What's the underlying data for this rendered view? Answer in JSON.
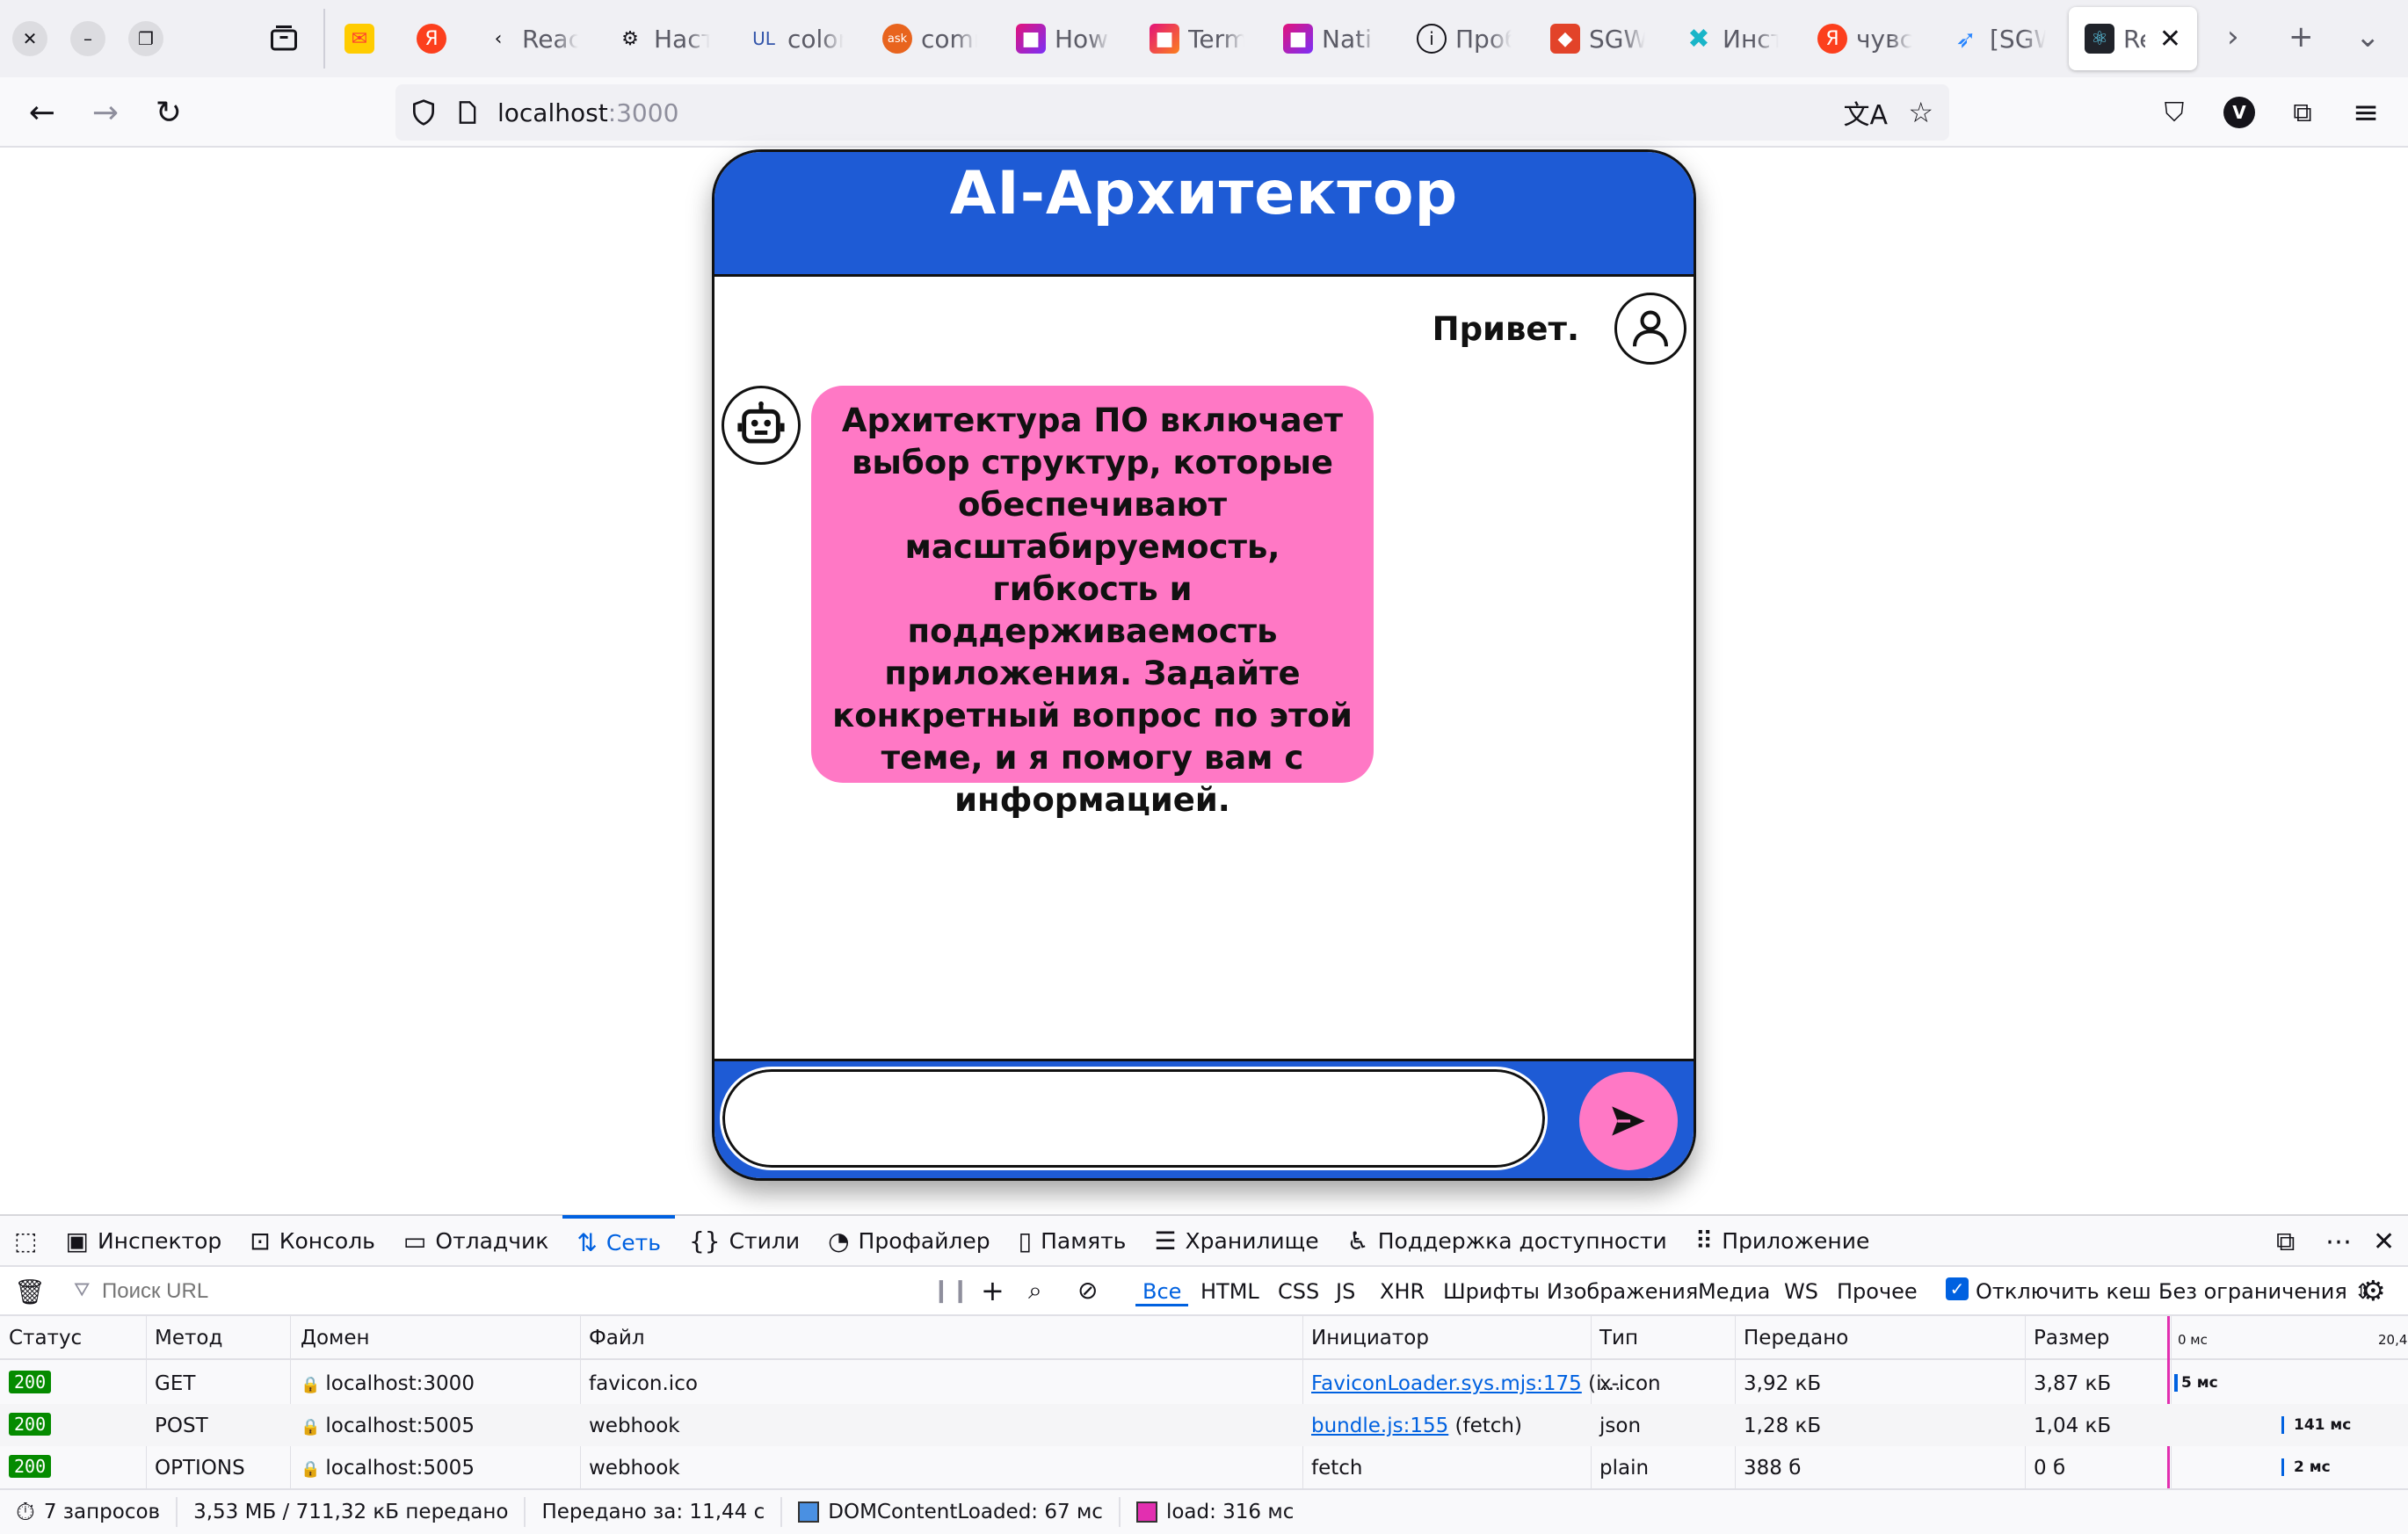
{
  "browser": {
    "tabs": [
      {
        "title": "",
        "favicon": "mail-icon",
        "color": "#ff3b30"
      },
      {
        "title": "",
        "favicon": "yandex-icon",
        "color": "#fc3f1d"
      },
      {
        "title": "Reac",
        "favicon": "chevron-left-icon",
        "color": "#15141a"
      },
      {
        "title": "Наст",
        "favicon": "gear-icon",
        "color": "#15141a"
      },
      {
        "title": "color",
        "favicon": "ul-icon",
        "color": "#3355aa"
      },
      {
        "title": "comr",
        "favicon": "ask-icon",
        "color": "#e8641e"
      },
      {
        "title": "How",
        "favicon": "jetbrains-icon",
        "color": "#e3127a"
      },
      {
        "title": "Term",
        "favicon": "jetbrains-icon",
        "color": "#e3127a"
      },
      {
        "title": "Nati",
        "favicon": "jetbrains-icon",
        "color": "#e3127a"
      },
      {
        "title": "Проб",
        "favicon": "info-icon",
        "color": "#15141a"
      },
      {
        "title": "SGW",
        "favicon": "gitlab-icon",
        "color": "#e24329"
      },
      {
        "title": "Инст",
        "favicon": "confluence-icon",
        "color": "#19b5c8"
      },
      {
        "title": "чувс",
        "favicon": "yandex-icon",
        "color": "#fc3f1d"
      },
      {
        "title": "[SGW",
        "favicon": "jira-icon",
        "color": "#2684ff"
      },
      {
        "title": "Re",
        "favicon": "react-icon",
        "color": "#149eca",
        "active": true
      }
    ],
    "url_host": "localhost",
    "url_port": ":3000",
    "profile_initial": "V"
  },
  "app": {
    "title": "AI-Архитектор",
    "user_message": "Привет.",
    "bot_message": "Архитектура ПО включает выбор структур, которые обеспечивают масштабируемость, гибкость и поддерживаемость приложения. Задайте конкретный вопрос по этой теме, и я помогу вам с информацией.",
    "input_value": "",
    "colors": {
      "header": "#1e5bd5",
      "bot_bubble": "#ff78c5",
      "send_button": "#ff78c5"
    }
  },
  "devtools": {
    "tabs": [
      "Инспектор",
      "Консоль",
      "Отладчик",
      "Сеть",
      "Стили",
      "Профайлер",
      "Память",
      "Хранилище",
      "Поддержка доступности",
      "Приложение"
    ],
    "active_tab": "Сеть",
    "filter_placeholder": "Поиск URL",
    "type_filters": [
      "Все",
      "HTML",
      "CSS",
      "JS",
      "XHR",
      "Шрифты",
      "Изображения",
      "Медиа",
      "WS",
      "Прочее"
    ],
    "disable_cache_label": "Отключить кеш",
    "throttling": "Без ограничения ⇕",
    "columns": [
      "Статус",
      "Метод",
      "Домен",
      "Файл",
      "Инициатор",
      "Тип",
      "Передано",
      "Размер"
    ],
    "waterfall_ticks": [
      "0 мс",
      "20,4"
    ],
    "requests": [
      {
        "status": "200",
        "method": "GET",
        "domain": "localhost:3000",
        "file": "favicon.ico",
        "initiator_link": "FaviconLoader.sys.mjs:175",
        "initiator_rest": " (i...",
        "type": "x-icon",
        "transferred": "3,92 кБ",
        "size": "3,87 кБ",
        "timing": "5 мс"
      },
      {
        "status": "200",
        "method": "POST",
        "domain": "localhost:5005",
        "file": "webhook",
        "initiator_link": "bundle.js:155",
        "initiator_rest": " (fetch)",
        "type": "json",
        "transferred": "1,28 кБ",
        "size": "1,04 кБ",
        "timing": "141 мс"
      },
      {
        "status": "200",
        "method": "OPTIONS",
        "domain": "localhost:5005",
        "file": "webhook",
        "initiator_link": "",
        "initiator_rest": "fetch",
        "type": "plain",
        "transferred": "388 б",
        "size": "0 б",
        "timing": "2 мс"
      }
    ],
    "summary": {
      "requests": "7 запросов",
      "transferred": "3,53 МБ / 711,32 кБ передано",
      "finished": "Передано за: 11,44 с",
      "dom_loaded": "DOMContentLoaded: 67 мс",
      "load": "load: 316 мс",
      "dom_color": "#4a90e2",
      "load_color": "#e22fb0"
    }
  }
}
